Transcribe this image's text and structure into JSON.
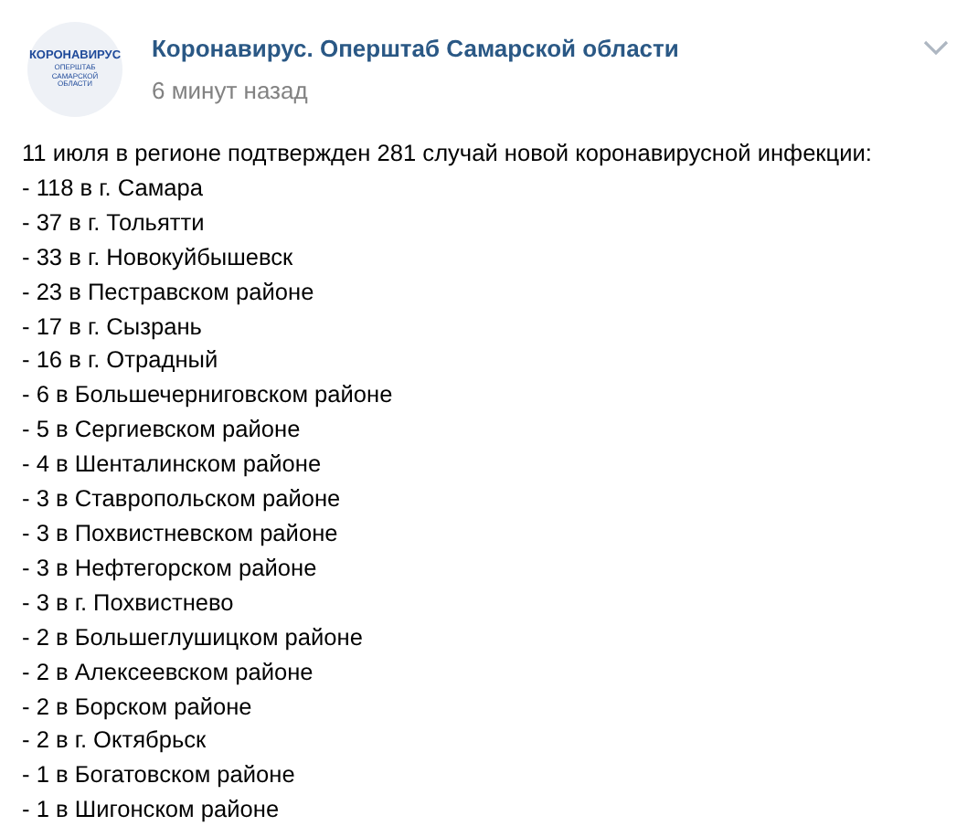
{
  "post": {
    "author": "Коронавирус. Оперштаб Самарской области",
    "time": "6 минут назад",
    "avatar": {
      "title": "КОРОНАВИРУС",
      "subtitle": "ОПЕРШТАБ САМАРСКОЙ ОБЛАСТИ"
    },
    "lines": [
      "11 июля в регионе подтвержден 281 случай новой коронавирусной инфекции:",
      "- 118 в г. Самара",
      "- 37 в г. Тольятти",
      "- 33 в г. Новокуйбышевск",
      "- 23 в Пестравском районе",
      "- 17 в г. Сызрань",
      "- 16 в г. Отрадный",
      "- 6 в Большечерниговском районе",
      "- 5 в Сергиевском районе",
      "- 4 в Шенталинском районе",
      "- 3 в Ставропольском районе",
      "- 3 в Похвистневском районе",
      "- 3 в Нефтегорском районе",
      "- 3 в г. Похвистнево",
      "- 2 в Большеглушицком районе",
      "- 2 в Алексеевском районе",
      "- 2 в Борском районе",
      "- 2 в г. Октябрьск",
      "- 1 в Богатовском районе",
      "- 1 в Шигонском районе"
    ]
  }
}
